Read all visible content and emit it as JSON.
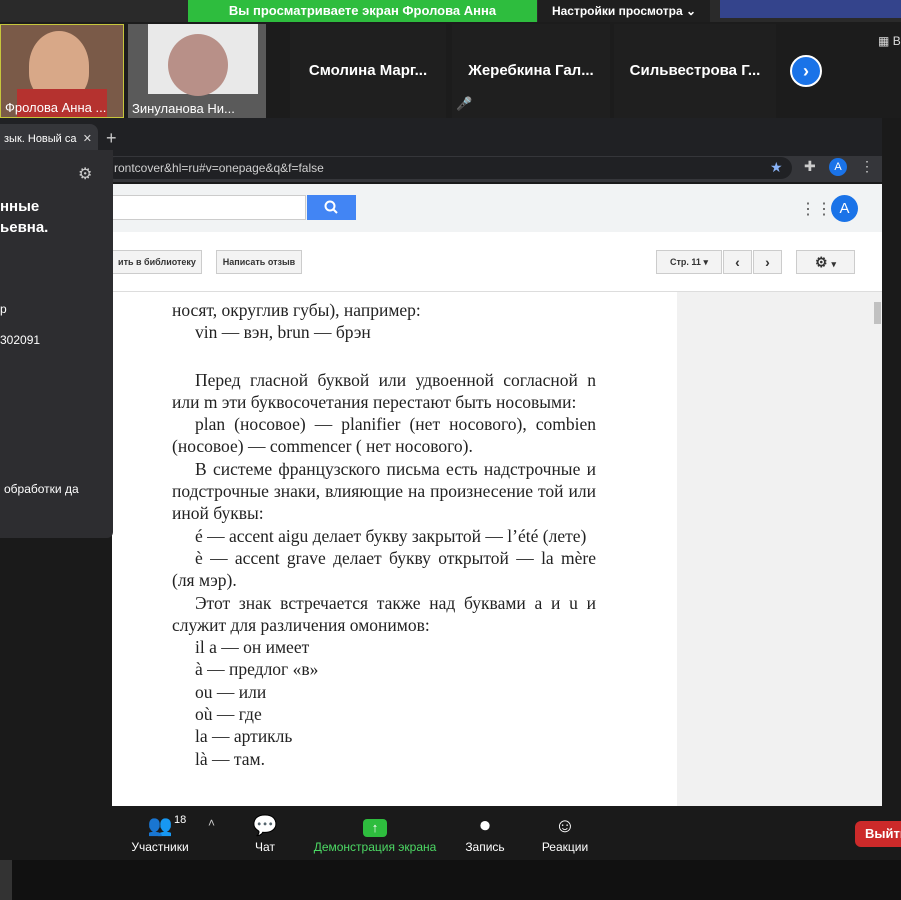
{
  "zoom": {
    "share_banner": "Вы просматриваете экран Фролова Анна Васильевна",
    "view_settings": "Настройки просмотра",
    "top_right_label": "В",
    "participants": {
      "video": [
        {
          "name": "Фролова Анна ..."
        },
        {
          "name": "Зинуланова Ни..."
        }
      ],
      "tiles": [
        {
          "name": "Смолина  Марг..."
        },
        {
          "name": "Жеребкина  Гал..."
        },
        {
          "name": "Сильвестрова  Г..."
        }
      ]
    },
    "panel": {
      "title_line1": "нные",
      "title_line2": "ьевна.",
      "line_r": "р",
      "id_fragment": "302091",
      "processing": "обработки да"
    },
    "controls": {
      "participants_label": "Участники",
      "participants_count": "18",
      "chat_label": "Чат",
      "share_label": "Демонстрация экрана",
      "record_label": "Запись",
      "reactions_label": "Реакции",
      "leave_label": "Выйти"
    }
  },
  "browser": {
    "tab_title": "зык. Новый са",
    "url": "rontcover&hl=ru#v=onepage&q&f=false",
    "avatar_letter": "A"
  },
  "books": {
    "add_library": "ить в библиотеку",
    "write_review": "Написать отзыв",
    "page_label": "Стр. 11"
  },
  "book_page": {
    "lines": [
      "носят, округлив губы), например:",
      "vin — вэн, brun — брэн",
      "",
      "Перед гласной буквой или удвоенной согласной n или m эти буквосочетания перестают быть носовыми:",
      "plan (носовое) — planifier (нет носового), combien (носовое) — commencer ( нет носового).",
      "В системе французского письма есть надстрочные и подстрочные знаки, влияющие на произнесение той или иной буквы:",
      "é — accent aigu делает букву закрытой — l’été (лете)",
      "è — accent grave делает букву открытой — la mère (ля мэр).",
      "Этот знак встречается также над буквами a и u и служит для различения омонимов:",
      "il a — он имеет",
      "à — предлог «в»",
      "ou — или",
      "où — где",
      "la — артикль",
      "là — там."
    ]
  }
}
